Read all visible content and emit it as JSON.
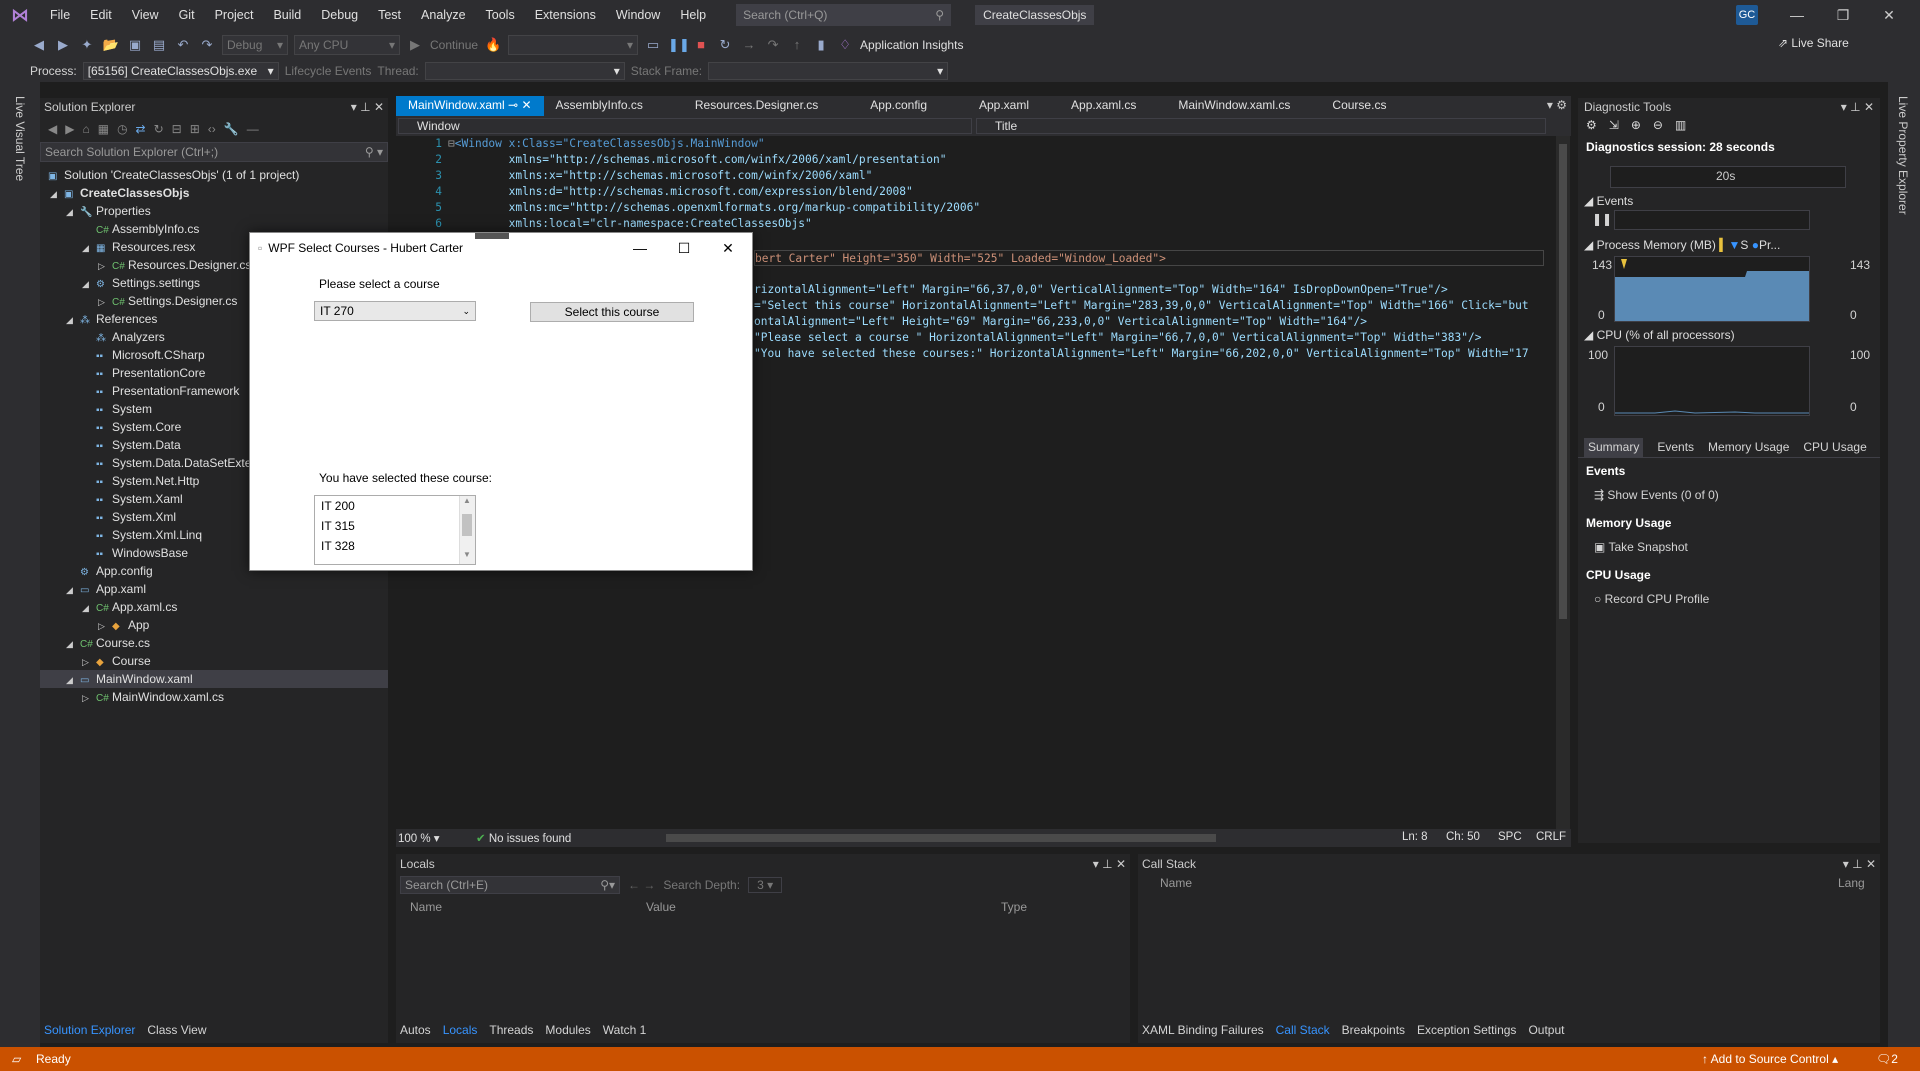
{
  "menubar": {
    "items": [
      "File",
      "Edit",
      "View",
      "Git",
      "Project",
      "Build",
      "Debug",
      "Test",
      "Analyze",
      "Tools",
      "Extensions",
      "Window",
      "Help"
    ],
    "search_placeholder": "Search (Ctrl+Q)",
    "solution_title": "CreateClassesObjs",
    "user_initials": "GC"
  },
  "toolbar": {
    "config": "Debug",
    "platform": "Any CPU",
    "continue_label": "Continue",
    "app_insights": "Application Insights",
    "live_share": "Live Share"
  },
  "procbar": {
    "process_label": "Process:",
    "process_value": "[65156] CreateClassesObjs.exe",
    "lifecycle": "Lifecycle Events",
    "thread_label": "Thread:",
    "stack_frame_label": "Stack Frame:"
  },
  "side_strips": {
    "left": "Live Visual Tree",
    "right": "Live Property Explorer"
  },
  "solution_explorer": {
    "title": "Solution Explorer",
    "search_placeholder": "Search Solution Explorer (Ctrl+;)",
    "rows": [
      {
        "label": "Solution 'CreateClassesObjs' (1 of 1 project)"
      },
      {
        "label": "CreateClassesObjs"
      },
      {
        "label": "Properties"
      },
      {
        "label": "AssemblyInfo.cs"
      },
      {
        "label": "Resources.resx"
      },
      {
        "label": "Resources.Designer.cs"
      },
      {
        "label": "Settings.settings"
      },
      {
        "label": "Settings.Designer.cs"
      },
      {
        "label": "References"
      },
      {
        "label": "Analyzers"
      },
      {
        "label": "Microsoft.CSharp"
      },
      {
        "label": "PresentationCore"
      },
      {
        "label": "PresentationFramework"
      },
      {
        "label": "System"
      },
      {
        "label": "System.Core"
      },
      {
        "label": "System.Data"
      },
      {
        "label": "System.Data.DataSetExtensions"
      },
      {
        "label": "System.Net.Http"
      },
      {
        "label": "System.Xaml"
      },
      {
        "label": "System.Xml"
      },
      {
        "label": "System.Xml.Linq"
      },
      {
        "label": "WindowsBase"
      },
      {
        "label": "App.config"
      },
      {
        "label": "App.xaml"
      },
      {
        "label": "App.xaml.cs"
      },
      {
        "label": "App"
      },
      {
        "label": "Course.cs"
      },
      {
        "label": "Course"
      },
      {
        "label": "MainWindow.xaml"
      },
      {
        "label": "MainWindow.xaml.cs"
      }
    ],
    "tab_active": "Solution Explorer",
    "tab_other": "Class View"
  },
  "editor": {
    "tabs": [
      "MainWindow.xaml",
      "AssemblyInfo.cs",
      "Resources.Designer.cs",
      "App.config",
      "App.xaml",
      "App.xaml.cs",
      "MainWindow.xaml.cs",
      "Course.cs"
    ],
    "nav_left": "Window",
    "nav_right": "Title",
    "lines": [
      {
        "n": "1",
        "text": "<Window x:Class=\"CreateClassesObjs.MainWindow\""
      },
      {
        "n": "2",
        "text": "        xmlns=\"http://schemas.microsoft.com/winfx/2006/xaml/presentation\""
      },
      {
        "n": "3",
        "text": "        xmlns:x=\"http://schemas.microsoft.com/winfx/2006/xaml\""
      },
      {
        "n": "4",
        "text": "        xmlns:d=\"http://schemas.microsoft.com/expression/blend/2008\""
      },
      {
        "n": "5",
        "text": "        xmlns:mc=\"http://schemas.openxmlformats.org/markup-compatibility/2006\""
      },
      {
        "n": "6",
        "text": "        xmlns:local=\"clr-namespace:CreateClassesObjs\""
      }
    ],
    "partial_lines": [
      {
        "text": "bert Carter\" Height=\"350\" Width=\"525\" Loaded=\"Window_Loaded\">"
      },
      {
        "text": "rizontalAlignment=\"Left\" Margin=\"66,37,0,0\" VerticalAlignment=\"Top\" Width=\"164\" IsDropDownOpen=\"True\"/>"
      },
      {
        "text": "=\"Select this course\" HorizontalAlignment=\"Left\" Margin=\"283,39,0,0\" VerticalAlignment=\"Top\" Width=\"166\" Click=\"but"
      },
      {
        "text": "ontalAlignment=\"Left\" Height=\"69\" Margin=\"66,233,0,0\" VerticalAlignment=\"Top\" Width=\"164\"/>"
      },
      {
        "text": "\"Please select a course \" HorizontalAlignment=\"Left\" Margin=\"66,7,0,0\" VerticalAlignment=\"Top\" Width=\"383\"/>"
      },
      {
        "text": "\"You have selected these courses:\" HorizontalAlignment=\"Left\" Margin=\"66,202,0,0\" VerticalAlignment=\"Top\" Width=\"17"
      }
    ],
    "status": {
      "zoom": "100 %",
      "issues": "No issues found",
      "ln": "Ln: 8",
      "ch": "Ch: 50",
      "spc": "SPC",
      "crlf": "CRLF"
    }
  },
  "diagnostics": {
    "title": "Diagnostic Tools",
    "session": "Diagnostics session: 28 seconds",
    "timeline_label": "20s",
    "events_label": "Events",
    "memory_label": "Process Memory (MB)",
    "memory_legend_s": "S",
    "memory_legend_pr": "Pr...",
    "memory_max": "143",
    "memory_min": "0",
    "cpu_label": "CPU (% of all processors)",
    "cpu_max": "100",
    "cpu_min": "0",
    "tabs": [
      "Summary",
      "Events",
      "Memory Usage",
      "CPU Usage"
    ],
    "sections": [
      {
        "heading": "Events",
        "action": "Show Events (0 of 0)"
      },
      {
        "heading": "Memory Usage",
        "action": "Take Snapshot"
      },
      {
        "heading": "CPU Usage",
        "action": "Record CPU Profile"
      }
    ]
  },
  "locals": {
    "title": "Locals",
    "search_placeholder": "Search (Ctrl+E)",
    "depth_label": "Search Depth:",
    "depth_value": "3",
    "columns": [
      "Name",
      "Value",
      "Type"
    ]
  },
  "callstack": {
    "title": "Call Stack",
    "columns": [
      "Name",
      "Lang"
    ]
  },
  "bottom_tabs_left": [
    "Autos",
    "Locals",
    "Threads",
    "Modules",
    "Watch 1"
  ],
  "bottom_tabs_left_active": "Locals",
  "bottom_tabs_right": [
    "XAML Binding Failures",
    "Call Stack",
    "Breakpoints",
    "Exception Settings",
    "Output"
  ],
  "bottom_tabs_right_active": "Call Stack",
  "statusbar": {
    "left": "Ready",
    "right": "Add to Source Control",
    "notif": "2"
  },
  "wpf": {
    "title": "WPF Select Courses - Hubert Carter",
    "prompt": "Please select a course",
    "combo_value": "IT 270",
    "button": "Select this course",
    "selected_label": "You have selected these course:",
    "selected_items": [
      "IT 200",
      "IT 315",
      "IT 328"
    ]
  },
  "colors": {
    "accent": "#007acc",
    "status": "#ca5100",
    "selection": "#3f3f46"
  }
}
